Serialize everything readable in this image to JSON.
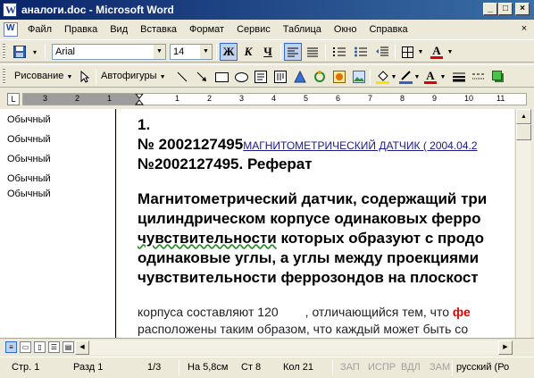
{
  "window": {
    "title": "аналоги.doc - Microsoft Word"
  },
  "menu": {
    "items": [
      "Файл",
      "Правка",
      "Вид",
      "Вставка",
      "Формат",
      "Сервис",
      "Таблица",
      "Окно",
      "Справка"
    ]
  },
  "formatting": {
    "font": "Arial",
    "size": "14",
    "bold": "Ж",
    "italic": "К",
    "underline": "Ч",
    "font_color_letter": "A"
  },
  "drawing": {
    "draw_label": "Рисование",
    "autoshapes_label": "Автофигуры",
    "font_color_letter": "A"
  },
  "ruler": {
    "numbers": [
      "3",
      "2",
      "1",
      "1",
      "2",
      "3",
      "4",
      "5",
      "6",
      "7",
      "8",
      "9",
      "10",
      "11"
    ]
  },
  "styles": [
    "Обычный",
    "Обычный",
    "Обычный",
    "Обычный",
    "Обычный"
  ],
  "document": {
    "num": "1.",
    "patent_bold": "№ 2002127495",
    "patent_link": "МАГНИТОМЕТРИЧЕСКИЙ ДАТЧИК ( 2004.04.2",
    "abstract_title": "№2002127495. Реферат",
    "line1": "Магнитометрический датчик, содержащий три",
    "line2": "цилиндрическом корпусе одинаковых ферро",
    "line3_wavy": "чувствительности",
    "line3_rest": " которых образуют с продо",
    "line4": "одинаковые углы, а углы между проекциями",
    "line5": "чувствительности феррозондов на плоскост",
    "body1_a": "корпуса составляют 120",
    "body1_b": ", отличающийся тем, что ",
    "body1_red": "фе",
    "body2": "расположены таким образом, что каждый может быть со"
  },
  "status": {
    "page": "Стр. 1",
    "section": "Разд 1",
    "pages": "1/3",
    "at": "На 5,8см",
    "line": "Ст 8",
    "col": "Кол 21",
    "rec": "ЗАП",
    "trk": "ИСПР",
    "ext": "ВДЛ",
    "ovr": "ЗАМ",
    "lang": "русский (Ро"
  }
}
